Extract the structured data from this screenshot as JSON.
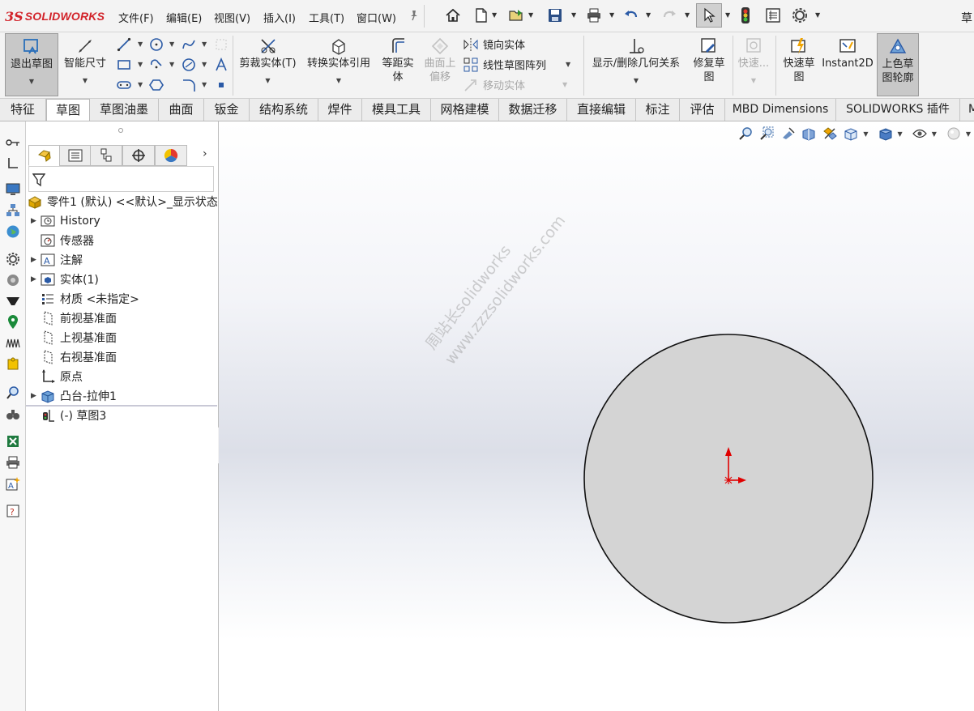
{
  "app": {
    "logo_ds": "3S",
    "logo_brand": "SOLIDWORKS"
  },
  "menu": [
    "文件(F)",
    "编辑(E)",
    "视图(V)",
    "插入(I)",
    "工具(T)",
    "窗口(W)"
  ],
  "top_right_label": "草",
  "commands": {
    "exit_sketch": "退出草图",
    "smart_dimension": "智能尺寸",
    "trim": "剪裁实体(T)",
    "convert": "转换实体引用",
    "offset_line1": "等距实",
    "offset_line2": "体",
    "surface_offset_line1": "曲面上",
    "surface_offset_line2": "偏移",
    "mirror": "镜向实体",
    "linear_pattern": "线性草图阵列",
    "move": "移动实体",
    "show_relations": "显示/删除几何关系",
    "repair_line1": "修复草",
    "repair_line2": "图",
    "quick_snap": "快速...",
    "rapid_line1": "快速草",
    "rapid_line2": "图",
    "instant2d": "Instant2D",
    "shaded_line1": "上色草",
    "shaded_line2": "图轮廓"
  },
  "tabs": [
    "特征",
    "草图",
    "草图油墨",
    "曲面",
    "钣金",
    "结构系统",
    "焊件",
    "模具工具",
    "网格建模",
    "数据迁移",
    "直接编辑",
    "标注",
    "评估",
    "MBD Dimensions",
    "SOLIDWORKS 插件",
    "M"
  ],
  "active_tab": "草图",
  "tree": {
    "root": "零件1 (默认) <<默认>_显示状态",
    "items": [
      {
        "label": "History",
        "expandable": true,
        "icon": "history-icon"
      },
      {
        "label": "传感器",
        "expandable": false,
        "icon": "sensor-icon"
      },
      {
        "label": "注解",
        "expandable": true,
        "icon": "annotation-icon"
      },
      {
        "label": "实体(1)",
        "expandable": true,
        "icon": "solid-bodies-icon"
      },
      {
        "label": "材质 <未指定>",
        "expandable": false,
        "icon": "material-icon"
      },
      {
        "label": "前视基准面",
        "expandable": false,
        "icon": "plane-icon"
      },
      {
        "label": "上视基准面",
        "expandable": false,
        "icon": "plane-icon"
      },
      {
        "label": "右视基准面",
        "expandable": false,
        "icon": "plane-icon"
      },
      {
        "label": "原点",
        "expandable": false,
        "icon": "origin-icon"
      },
      {
        "label": "凸台-拉伸1",
        "expandable": true,
        "icon": "extrude-icon"
      },
      {
        "label": "(-) 草图3",
        "expandable": false,
        "icon": "sketch-icon"
      }
    ]
  },
  "watermark": {
    "line1": "周站长solidworks",
    "line2": "www.zzzsolidworks.com"
  },
  "colors": {
    "accent_red": "#d2232a",
    "sketch_fill": "#d4d4d4",
    "origin_red": "#e00000"
  }
}
